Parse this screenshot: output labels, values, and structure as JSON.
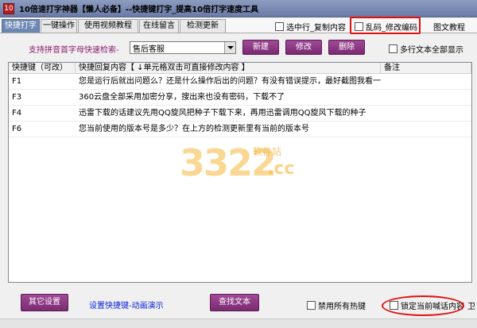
{
  "window": {
    "title": "10倍速打字神器【懒人必备】--快捷键打字_提高10倍打字速度工具",
    "icon_text": "10"
  },
  "tabs": [
    {
      "label": "快捷打字",
      "active": true
    },
    {
      "label": "一键操作",
      "active": false
    },
    {
      "label": "使用视频教程",
      "active": false
    },
    {
      "label": "在线留言",
      "active": false
    },
    {
      "label": "检测更新",
      "active": false
    }
  ],
  "top_options": {
    "select_copy": "选中行_复制内容",
    "garbled_edit": "乱码_修改编码",
    "graphic_tutorial": "图文教程"
  },
  "toolbar": {
    "search_label": "支持拼音首字母快速检索-",
    "combo_value": "售后客服",
    "new": "新建",
    "edit": "修改",
    "delete": "删除",
    "multiline": "多行文本全部显示"
  },
  "table": {
    "headers": [
      "快捷键（可改）",
      "快捷回复内容【 ↓单元格双击可直接修改内容 】",
      "备注"
    ],
    "rows": [
      {
        "key": "F1",
        "content": "您是运行后就出问题么？还是什么操作后出的问题？有没有错误提示，最好截图我看一下。",
        "note": ""
      },
      {
        "key": "F3",
        "content": "360云盘全部采用加密分享，搜出来也没有密码，下载不了",
        "note": ""
      },
      {
        "key": "F4",
        "content": "迅雷下载的话建议先用QQ旋风把种子下载下来，再用迅雷调用QQ旋风下载的种子",
        "note": ""
      },
      {
        "key": "F6",
        "content": "您当前使用的版本号是多少？在上方的检测更新里有当前的版本号",
        "note": ""
      }
    ]
  },
  "watermark": {
    "digits": "3322",
    "suffix": ".cc",
    "site": "软件站"
  },
  "bottom": {
    "other_settings": "其它设置",
    "link": "设置快捷键-动画演示",
    "find_text": "查找文本",
    "disable_hotkeys": "禁用所有热键",
    "lock_dialog": "锁定当前喊话内容",
    "partial_right": "卫"
  },
  "colors": {
    "accent": "#8b2f82",
    "highlight": "#e01010",
    "tab_active": "#6d87b3"
  }
}
